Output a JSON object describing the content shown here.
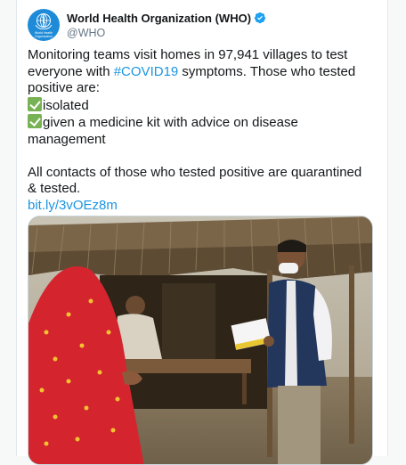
{
  "account": {
    "name": "World Health Organization (WHO)",
    "handle": "@WHO",
    "avatar_text": "World Health Organization",
    "verified": true
  },
  "tweet": {
    "line1": "Monitoring teams visit homes in 97,941 villages to test",
    "line2_pre": "everyone with ",
    "hashtag": "#COVID19",
    "line2_post": " symptoms. Those who tested",
    "line3": "positive are:",
    "bullet1": "isolated",
    "bullet2": "given a medicine kit with advice on disease",
    "bullet2_cont": "management",
    "line_contacts1": "All contacts of those who tested positive are quarantined",
    "line_contacts2": "& tested.",
    "link": "bit.ly/3vOEz8m"
  },
  "media": {
    "description_icon": "photo-icon"
  },
  "colors": {
    "link": "#1b95e0",
    "verified": "#1da1f2",
    "avatar": "#1d8bd8",
    "check": "#77b255"
  }
}
